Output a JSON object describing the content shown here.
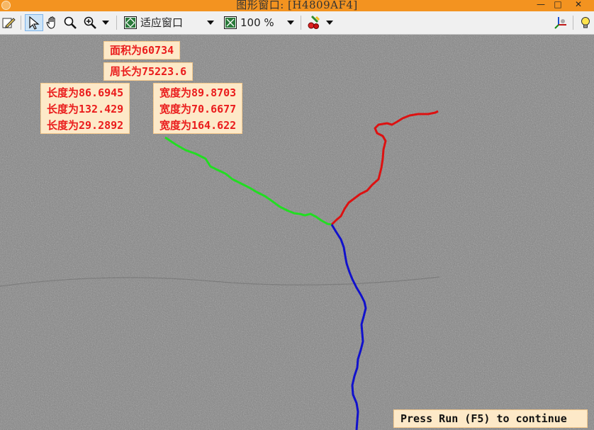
{
  "window": {
    "title": "图形窗口: [H4809AF4]",
    "minimize_glyph": "—",
    "maximize_glyph": "□",
    "close_glyph": "✕"
  },
  "toolbar": {
    "zoom_fit_label": "适应窗口",
    "zoom_percent_label": "100 %",
    "icons": [
      "edit-icon",
      "pointer-icon",
      "hand-pan-icon",
      "magnifier-icon",
      "zoom-in-icon",
      "fit-window-icon",
      "zoom-percent-icon",
      "color-paint-icon",
      "3d-axes-icon",
      "lightbulb-icon"
    ]
  },
  "measurements": {
    "area": "面积为60734",
    "perimeter": "周长为75223.6",
    "lengths": [
      "长度为86.6945",
      "长度为132.429",
      "长度为29.2892"
    ],
    "widths": [
      "宽度为89.8703",
      "宽度为70.6677",
      "宽度为164.622"
    ]
  },
  "status": {
    "message": "Press Run (F5) to continue"
  },
  "colors": {
    "titlebar": "#f39320",
    "label_text": "#ea1c1c",
    "label_bg": "#fde9c8",
    "branch_green": "#22dd22",
    "branch_red": "#dd1111",
    "branch_blue": "#1111cc"
  }
}
